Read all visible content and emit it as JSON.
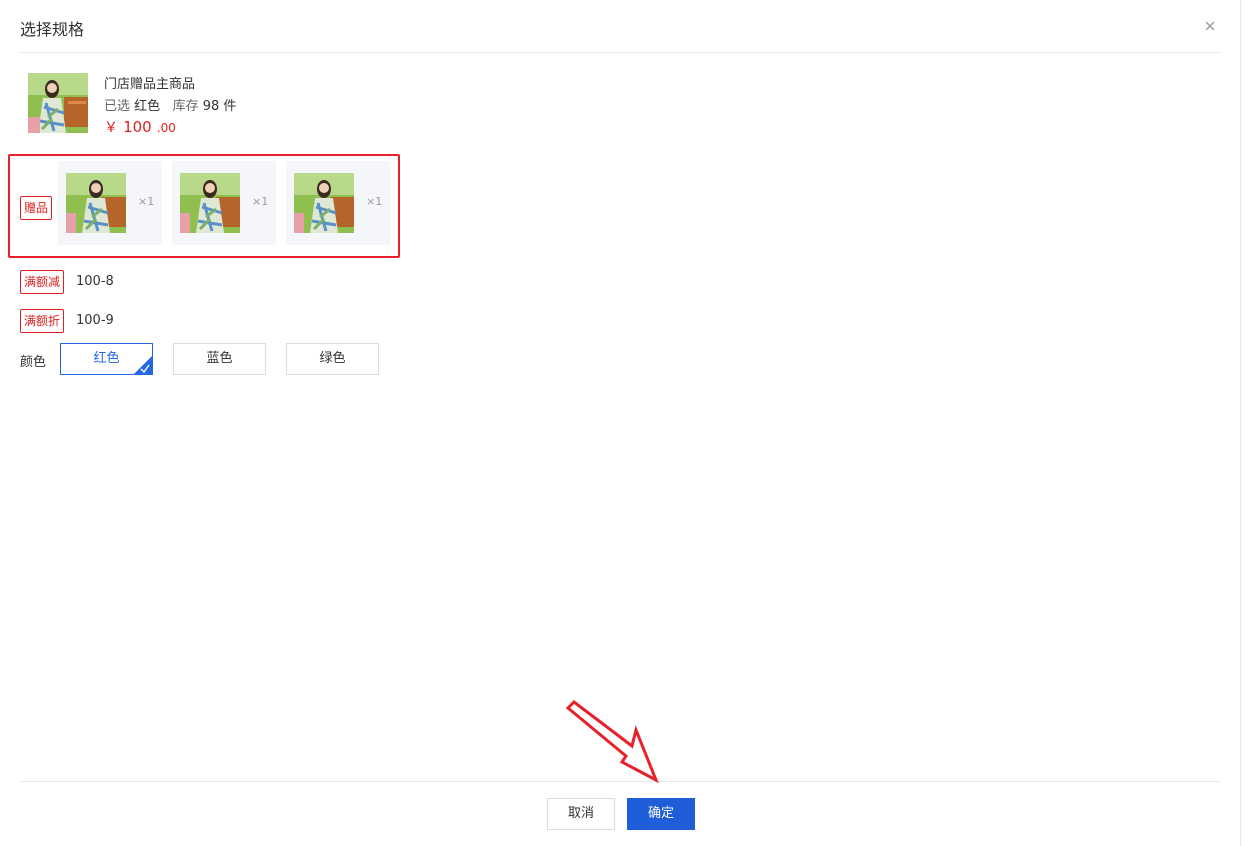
{
  "dialog": {
    "title": "选择规格",
    "close_icon": "close-icon"
  },
  "product": {
    "name": "门店赠品主商品",
    "selected_label": "已选",
    "selected_value": "红色",
    "stock_label": "库存",
    "stock_value": "98 件",
    "price_currency": "￥",
    "price_int": "100",
    "price_dec": ".00"
  },
  "gifts": {
    "tag": "赠品",
    "items": [
      {
        "qty": "×1"
      },
      {
        "qty": "×1"
      },
      {
        "qty": "×1"
      }
    ]
  },
  "promotions": [
    {
      "tag": "满额减",
      "text": "100-8"
    },
    {
      "tag": "满额折",
      "text": "100-9"
    }
  ],
  "spec": {
    "label": "颜色",
    "options": [
      "红色",
      "蓝色",
      "绿色"
    ],
    "selected": "红色"
  },
  "footer": {
    "cancel": "取消",
    "confirm": "确定"
  },
  "colors": {
    "accent": "#1f5ed8",
    "tag_red": "#e02020",
    "highlight_box": "#e8202a"
  }
}
